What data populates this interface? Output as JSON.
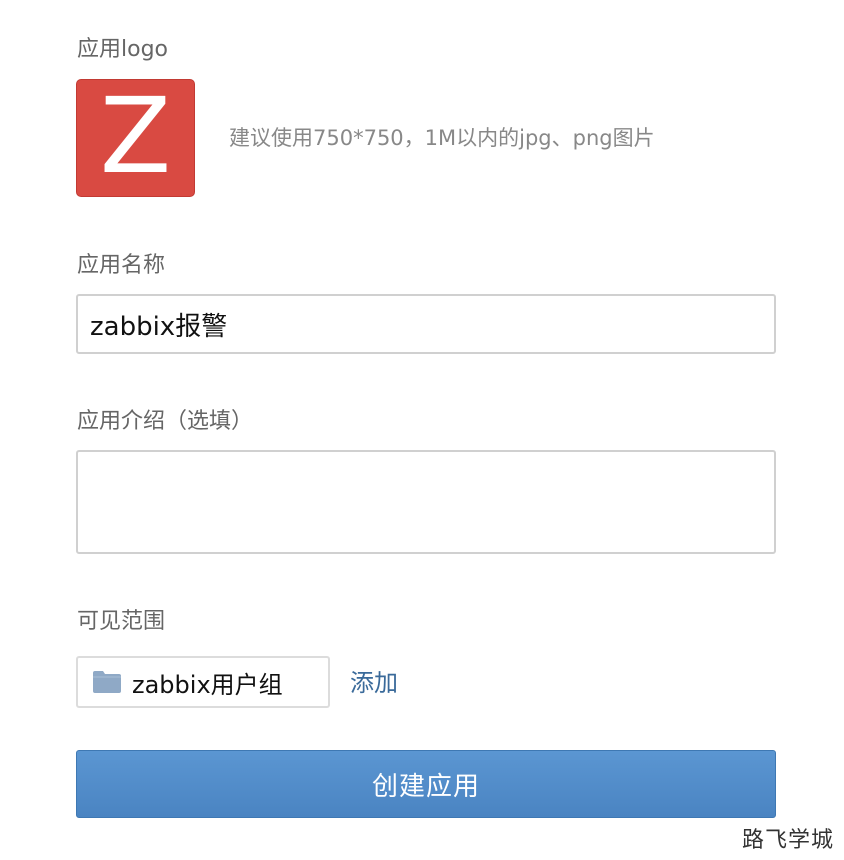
{
  "form": {
    "logo_label": "应用logo",
    "logo_letter": "Z",
    "logo_hint": "建议使用750*750，1M以内的jpg、png图片",
    "name_label": "应用名称",
    "name_value": "zabbix报警",
    "description_label": "应用介绍（选填）",
    "description_value": "",
    "visibility_label": "可见范围",
    "visibility_group": "zabbix用户组",
    "add_label": "添加",
    "submit_label": "创建应用"
  },
  "watermark": "路飞学城",
  "colors": {
    "logo_bg": "#d94a42",
    "button_bg": "#4a84c2",
    "link": "#3a6a9a",
    "folder_icon": "#8fa9c6"
  },
  "icons": {
    "group": "folder-icon"
  }
}
